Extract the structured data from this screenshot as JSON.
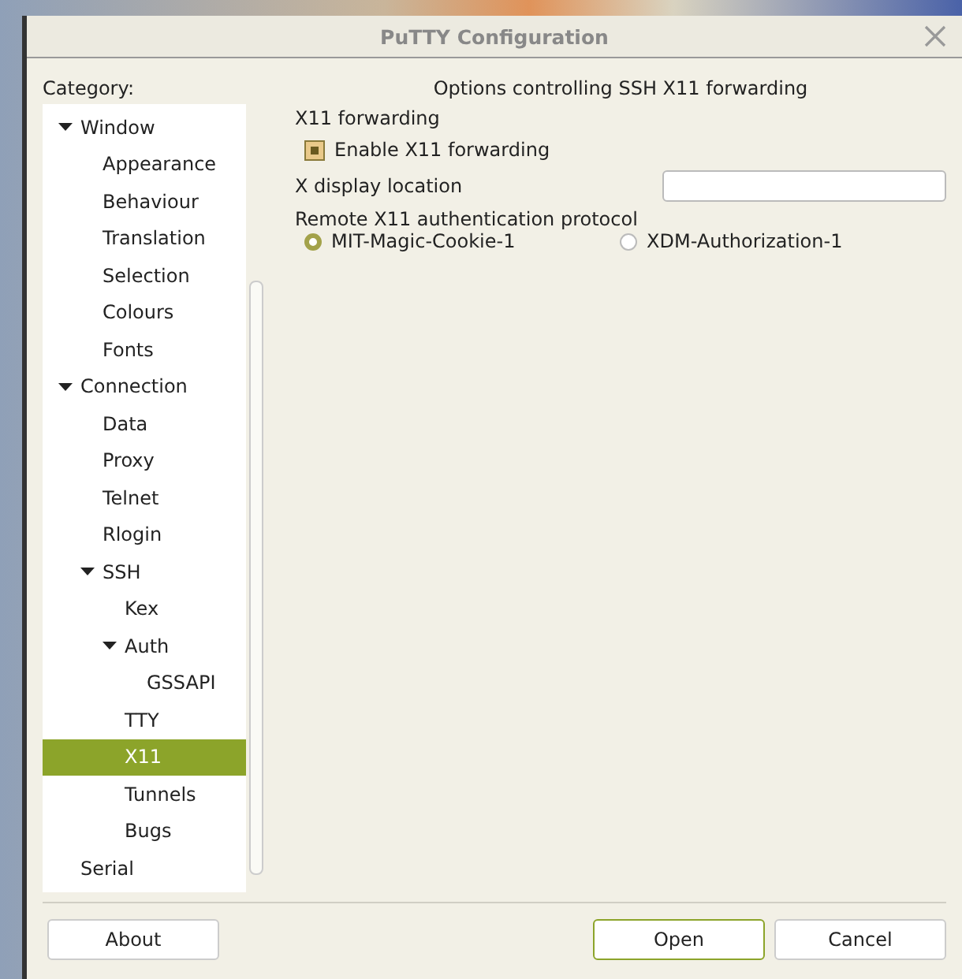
{
  "window": {
    "title": "PuTTY Configuration"
  },
  "category_label": "Category:",
  "tree": [
    {
      "label": "Window",
      "expanded": true,
      "selected": false,
      "children": [
        {
          "label": "Appearance",
          "selected": false
        },
        {
          "label": "Behaviour",
          "selected": false
        },
        {
          "label": "Translation",
          "selected": false
        },
        {
          "label": "Selection",
          "selected": false
        },
        {
          "label": "Colours",
          "selected": false
        },
        {
          "label": "Fonts",
          "selected": false
        }
      ]
    },
    {
      "label": "Connection",
      "expanded": true,
      "selected": false,
      "children": [
        {
          "label": "Data",
          "selected": false
        },
        {
          "label": "Proxy",
          "selected": false
        },
        {
          "label": "Telnet",
          "selected": false
        },
        {
          "label": "Rlogin",
          "selected": false
        },
        {
          "label": "SSH",
          "expanded": true,
          "selected": false,
          "children": [
            {
              "label": "Kex",
              "selected": false
            },
            {
              "label": "Auth",
              "expanded": true,
              "selected": false,
              "children": [
                {
                  "label": "GSSAPI",
                  "selected": false
                }
              ]
            },
            {
              "label": "TTY",
              "selected": false
            },
            {
              "label": "X11",
              "selected": true
            },
            {
              "label": "Tunnels",
              "selected": false
            },
            {
              "label": "Bugs",
              "selected": false
            }
          ]
        }
      ]
    },
    {
      "label": "Serial",
      "selected": false
    }
  ],
  "panel": {
    "heading": "Options controlling SSH X11 forwarding",
    "group_title": "X11 forwarding",
    "enable": {
      "label": "Enable X11 forwarding",
      "checked": true
    },
    "display": {
      "label": "X display location"
    },
    "protocol": {
      "label": "Remote X11 authentication protocol",
      "options": [
        {
          "label": "MIT-Magic-Cookie-1",
          "selected": true
        },
        {
          "label": "XDM-Authorization-1",
          "selected": false
        }
      ]
    }
  },
  "buttons": {
    "left": [
      "About"
    ],
    "right": [
      {
        "label": "Open",
        "default": true
      },
      {
        "label": "Cancel",
        "default": false
      }
    ]
  }
}
